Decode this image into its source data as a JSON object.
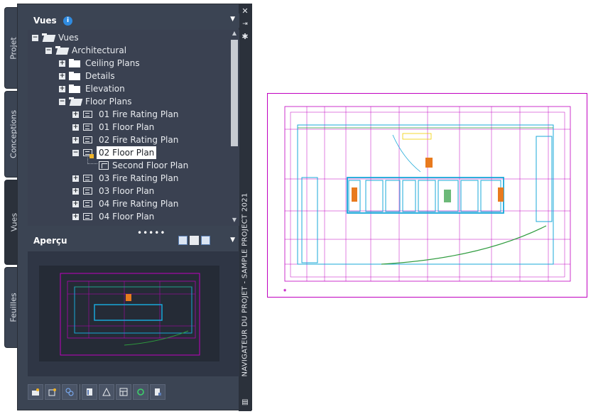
{
  "tabs": [
    {
      "label": "Projet"
    },
    {
      "label": "Conceptions"
    },
    {
      "label": "Vues"
    },
    {
      "label": "Feuilles"
    }
  ],
  "palette": {
    "title": "NAVIGATEUR DU PROJET - SAMPLE PROJECT 2021",
    "vues_header": "Vues",
    "apercu_header": "Aperçu"
  },
  "tree": {
    "root": "Vues",
    "architectural": "Architectural",
    "items": [
      {
        "label": "Ceiling Plans"
      },
      {
        "label": "Details"
      },
      {
        "label": "Elevation"
      },
      {
        "label": "Floor Plans"
      },
      {
        "label": "01 Fire Rating Plan"
      },
      {
        "label": "01 Floor Plan"
      },
      {
        "label": "02 Fire Rating Plan"
      },
      {
        "label": "02 Floor Plan"
      },
      {
        "label": "Second Floor Plan"
      },
      {
        "label": "03 Fire Rating Plan"
      },
      {
        "label": "03 Floor Plan"
      },
      {
        "label": "04 Fire Rating Plan"
      },
      {
        "label": "04 Floor Plan"
      }
    ],
    "selected": "02 Floor Plan"
  },
  "resize_grip": "•••••",
  "colors": {
    "panel_bg": "#3b4453",
    "tree_bg": "#3a4151",
    "frame_magenta": "#c000c0",
    "plan_cyan": "#18a8d8",
    "plan_green": "#2e9b3e",
    "plan_orange": "#e87a1e"
  }
}
